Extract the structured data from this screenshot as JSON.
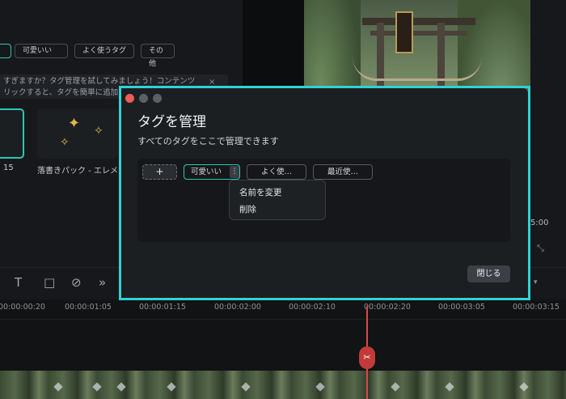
{
  "background": {
    "filter_tags": [
      "可愛いい",
      "よく使うタグ",
      "その他"
    ],
    "tip_text": "すぎますか？タグ管理を試してみましょう！コンテンツ",
    "tip_text_line2": "リックすると、タグを簡単に追加",
    "tip_close_icon": "×",
    "asset_label_1": "15",
    "asset_label_2": "落書きパック - エレメ",
    "side_time": "5:00",
    "timeline_ticks": [
      "00:00:00:20",
      "00:00:01:05",
      "00:00:01:15",
      "00:00:02:00",
      "00:00:02:10",
      "00:00:02:20",
      "00:00:03:05",
      "00:00:03:15"
    ]
  },
  "dialog": {
    "title": "タグを管理",
    "subtitle": "すべてのタグをここで管理できます",
    "add_label": "+",
    "tags": [
      {
        "label": "可愛いい",
        "active": true
      },
      {
        "label": "よく使…",
        "active": false
      },
      {
        "label": "最近使…",
        "active": false
      }
    ],
    "more_icon": "⋮",
    "context_menu": [
      "名前を変更",
      "削除"
    ],
    "close_label": "閉じる"
  },
  "colors": {
    "accent": "#2fd3d3",
    "close_dot": "#ee5d53",
    "playhead": "#d64a4a"
  }
}
